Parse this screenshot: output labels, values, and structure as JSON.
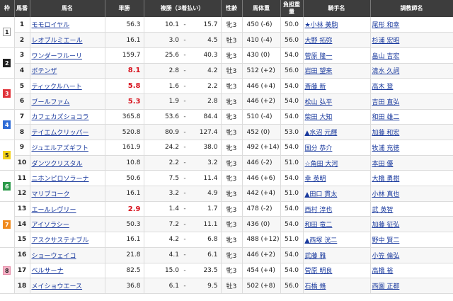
{
  "headers": {
    "frame": "枠",
    "number": "馬番",
    "horse": "馬名",
    "odds": "単勝",
    "place": "複勝（3着払い）",
    "sexage": "性齢",
    "weight": "馬体重",
    "burden": "負担重量",
    "jockey": "騎手名",
    "trainer": "調教師名"
  },
  "frame_colors": {
    "1": {
      "bg": "#ffffff",
      "fg": "#222222",
      "border": "#999999"
    },
    "2": {
      "bg": "#222222",
      "fg": "#ffffff",
      "border": "#222222"
    },
    "3": {
      "bg": "#e0333a",
      "fg": "#ffffff",
      "border": "#e0333a"
    },
    "4": {
      "bg": "#2e6bd6",
      "fg": "#ffffff",
      "border": "#2e6bd6"
    },
    "5": {
      "bg": "#f3d21a",
      "fg": "#222222",
      "border": "#f3d21a"
    },
    "6": {
      "bg": "#2c9a4a",
      "fg": "#ffffff",
      "border": "#2c9a4a"
    },
    "7": {
      "bg": "#f08a1e",
      "fg": "#ffffff",
      "border": "#f08a1e"
    },
    "8": {
      "bg": "#f7b3c8",
      "fg": "#222222",
      "border": "#e58aa6"
    }
  },
  "frames": [
    {
      "label": "1",
      "rows": 2
    },
    {
      "label": "2",
      "rows": 2
    },
    {
      "label": "3",
      "rows": 2
    },
    {
      "label": "4",
      "rows": 2
    },
    {
      "label": "5",
      "rows": 2
    },
    {
      "label": "6",
      "rows": 2
    },
    {
      "label": "7",
      "rows": 3
    },
    {
      "label": "8",
      "rows": 3
    }
  ],
  "rows": [
    {
      "num": "1",
      "horse": "モモロイヤル",
      "odds": "56.3",
      "pop": false,
      "place_low": "10.1",
      "place_dash": "-",
      "place_high": "15.7",
      "sexage": "牝3",
      "weight": "450 (-6)",
      "burden": "50.0",
      "jockey": "★小林 美駒",
      "trainer": "尾形 和幸"
    },
    {
      "num": "2",
      "horse": "レオブルミエール",
      "odds": "16.1",
      "pop": false,
      "place_low": "3.0",
      "place_dash": "-",
      "place_high": "4.5",
      "sexage": "牡3",
      "weight": "410 (-4)",
      "burden": "56.0",
      "jockey": "大野 拓弥",
      "trainer": "杉浦 宏昭"
    },
    {
      "num": "3",
      "horse": "ワンダーフルーリ",
      "odds": "159.7",
      "pop": false,
      "place_low": "25.6",
      "place_dash": "-",
      "place_high": "40.3",
      "sexage": "牝3",
      "weight": "430 (0)",
      "burden": "54.0",
      "jockey": "菅原 隆一",
      "trainer": "畠山 吉宏"
    },
    {
      "num": "4",
      "horse": "ボテンザ",
      "odds": "8.1",
      "pop": true,
      "place_low": "2.8",
      "place_dash": "-",
      "place_high": "4.2",
      "sexage": "牡3",
      "weight": "512 (+2)",
      "burden": "56.0",
      "jockey": "岩田 望来",
      "trainer": "清水 久詞"
    },
    {
      "num": "5",
      "horse": "ティックルハート",
      "odds": "5.8",
      "pop": true,
      "place_low": "1.6",
      "place_dash": "-",
      "place_high": "2.2",
      "sexage": "牝3",
      "weight": "446 (+4)",
      "burden": "54.0",
      "jockey": "斎藤 新",
      "trainer": "高木 登"
    },
    {
      "num": "6",
      "horse": "ブールファム",
      "odds": "5.3",
      "pop": true,
      "place_low": "1.9",
      "place_dash": "-",
      "place_high": "2.8",
      "sexage": "牝3",
      "weight": "446 (+2)",
      "burden": "54.0",
      "jockey": "松山 弘平",
      "trainer": "吉田 直弘"
    },
    {
      "num": "7",
      "horse": "カフェカズショコラ",
      "odds": "365.8",
      "pop": false,
      "place_low": "53.6",
      "place_dash": "-",
      "place_high": "84.4",
      "sexage": "牝3",
      "weight": "510 (-4)",
      "burden": "54.0",
      "jockey": "柴田 大知",
      "trainer": "和田 雄二"
    },
    {
      "num": "8",
      "horse": "テイエムクリッパー",
      "odds": "520.8",
      "pop": false,
      "place_low": "80.9",
      "place_dash": "-",
      "place_high": "127.4",
      "sexage": "牝3",
      "weight": "452 (0)",
      "burden": "53.0",
      "jockey": "▲水沼 元輝",
      "trainer": "加藤 和宏"
    },
    {
      "num": "9",
      "horse": "ジュエルアズギフト",
      "odds": "161.9",
      "pop": false,
      "place_low": "24.2",
      "place_dash": "-",
      "place_high": "38.0",
      "sexage": "牝3",
      "weight": "492 (+14)",
      "burden": "54.0",
      "jockey": "国分 恭介",
      "trainer": "牧浦 充徳"
    },
    {
      "num": "10",
      "horse": "ダンツクリスタル",
      "odds": "10.8",
      "pop": false,
      "place_low": "2.2",
      "place_dash": "-",
      "place_high": "3.2",
      "sexage": "牝3",
      "weight": "446 (-2)",
      "burden": "51.0",
      "jockey": "☆角田 大河",
      "trainer": "本田 優"
    },
    {
      "num": "11",
      "horse": "ニホンピロソラーナ",
      "odds": "50.6",
      "pop": false,
      "place_low": "7.5",
      "place_dash": "-",
      "place_high": "11.4",
      "sexage": "牝3",
      "weight": "446 (+6)",
      "burden": "54.0",
      "jockey": "幸 英明",
      "trainer": "大橋 勇樹"
    },
    {
      "num": "12",
      "horse": "マリブコーク",
      "odds": "16.1",
      "pop": false,
      "place_low": "3.2",
      "place_dash": "-",
      "place_high": "4.9",
      "sexage": "牝3",
      "weight": "442 (+4)",
      "burden": "51.0",
      "jockey": "▲田口 貫太",
      "trainer": "小林 真也"
    },
    {
      "num": "13",
      "horse": "エールレヴリー",
      "odds": "2.9",
      "pop": true,
      "place_low": "1.4",
      "place_dash": "-",
      "place_high": "1.7",
      "sexage": "牝3",
      "weight": "478 (-2)",
      "burden": "54.0",
      "jockey": "西村 淳也",
      "trainer": "武 英智"
    },
    {
      "num": "14",
      "horse": "アイソラシー",
      "odds": "50.3",
      "pop": false,
      "place_low": "7.2",
      "place_dash": "-",
      "place_high": "11.1",
      "sexage": "牝3",
      "weight": "436 (0)",
      "burden": "54.0",
      "jockey": "和田 竜二",
      "trainer": "加藤 征弘"
    },
    {
      "num": "15",
      "horse": "アスクサステナブル",
      "odds": "16.1",
      "pop": false,
      "place_low": "4.2",
      "place_dash": "-",
      "place_high": "6.8",
      "sexage": "牝3",
      "weight": "488 (+12)",
      "burden": "51.0",
      "jockey": "▲西塚 洸二",
      "trainer": "野中 賢二"
    },
    {
      "num": "16",
      "horse": "ショーウェイコ",
      "odds": "21.8",
      "pop": false,
      "place_low": "4.1",
      "place_dash": "-",
      "place_high": "6.1",
      "sexage": "牝3",
      "weight": "446 (+2)",
      "burden": "54.0",
      "jockey": "武藤 雅",
      "trainer": "小笠 倫弘"
    },
    {
      "num": "17",
      "horse": "ベルサーナ",
      "odds": "82.5",
      "pop": false,
      "place_low": "15.0",
      "place_dash": "-",
      "place_high": "23.5",
      "sexage": "牝3",
      "weight": "454 (+4)",
      "burden": "54.0",
      "jockey": "菅原 明良",
      "trainer": "高橋 裕"
    },
    {
      "num": "18",
      "horse": "メイショウエース",
      "odds": "36.8",
      "pop": false,
      "place_low": "6.1",
      "place_dash": "-",
      "place_high": "9.5",
      "sexage": "牡3",
      "weight": "502 (+8)",
      "burden": "56.0",
      "jockey": "石橋 脩",
      "trainer": "西園 正都"
    }
  ]
}
